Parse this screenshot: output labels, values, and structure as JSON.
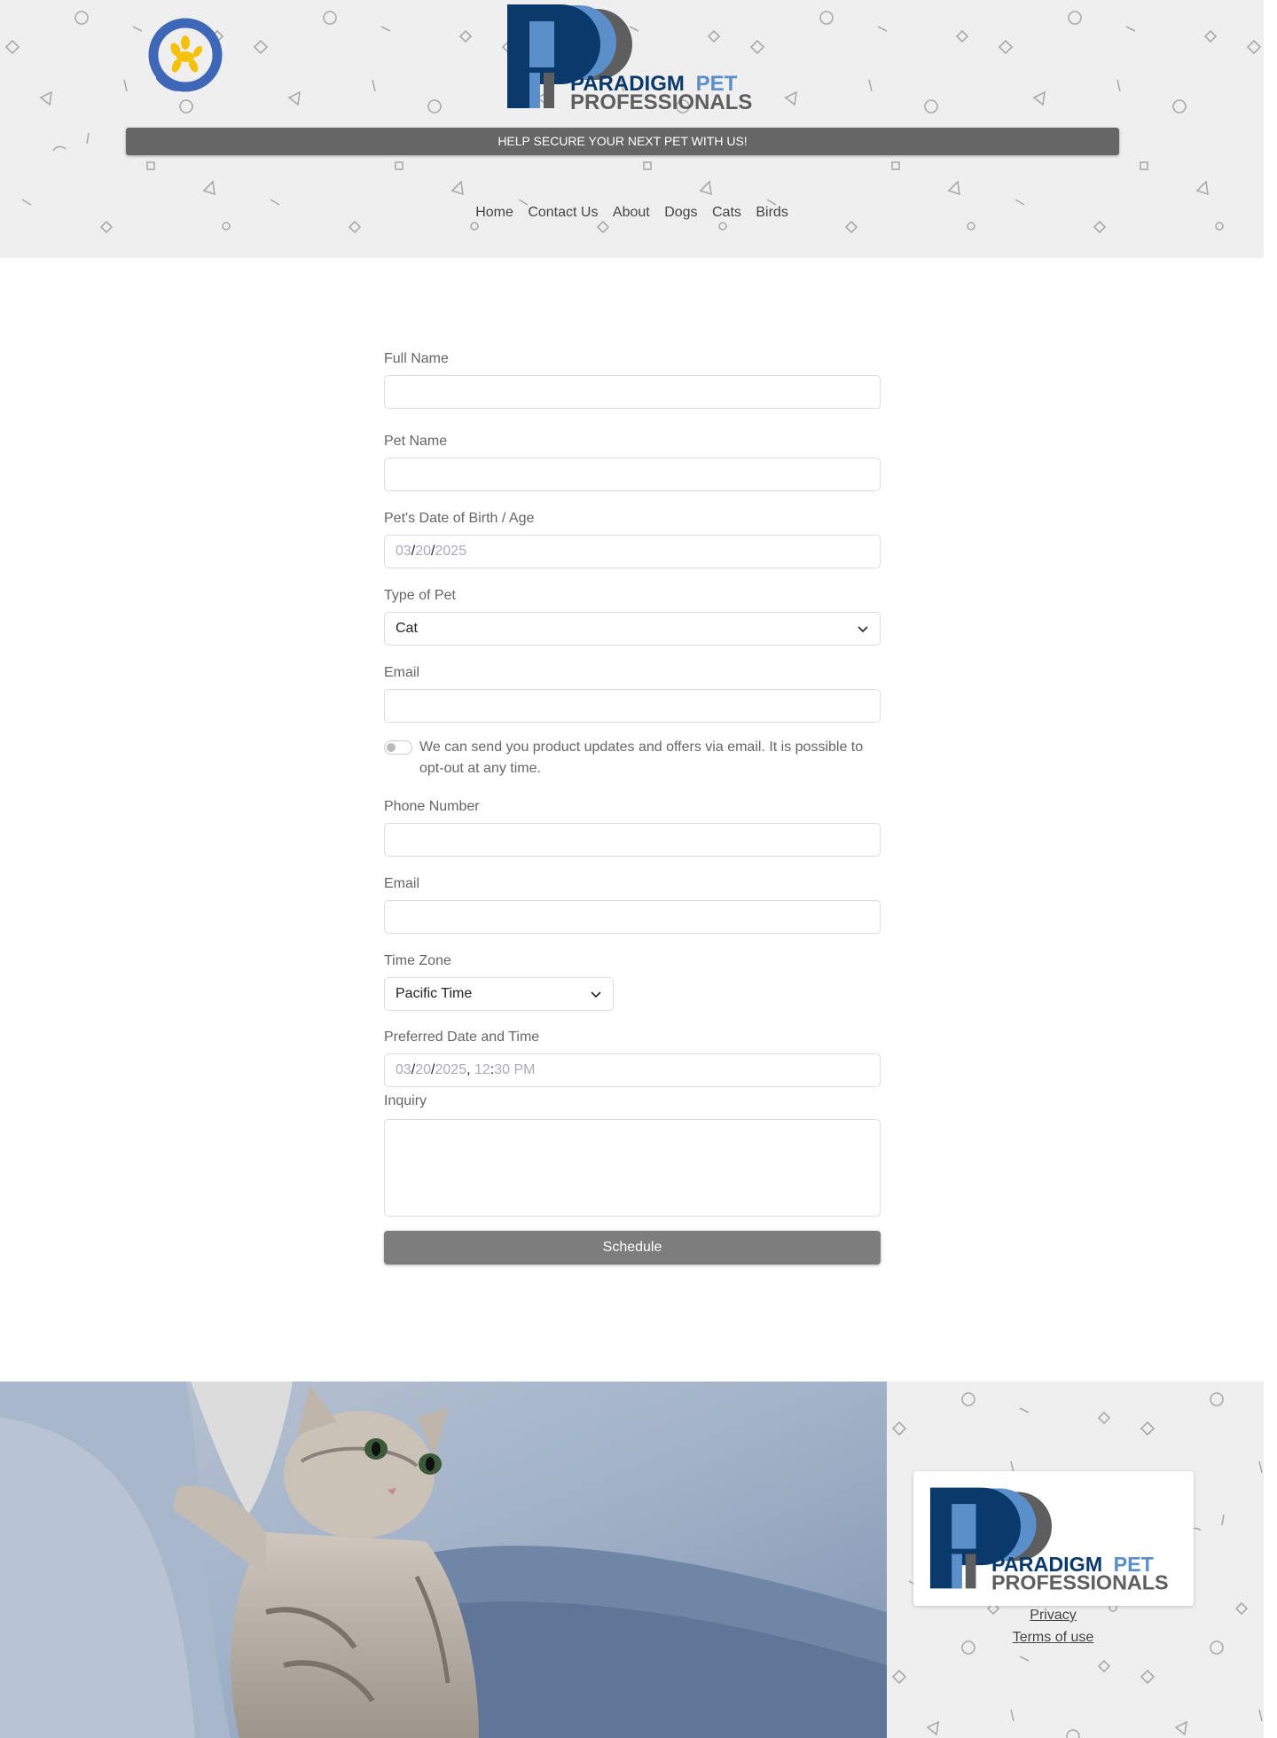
{
  "header": {
    "brand_line1_a": "PARADIGM",
    "brand_line1_b": "PET",
    "brand_line2": "PROFESSIONALS",
    "banner": "HELP SECURE YOUR NEXT PET WITH US!",
    "nav": [
      "Home",
      "Contact Us",
      "About",
      "Dogs",
      "Cats",
      "Birds"
    ]
  },
  "form": {
    "full_name": {
      "label": "Full Name",
      "value": ""
    },
    "pet_name": {
      "label": "Pet Name",
      "value": ""
    },
    "dob": {
      "label": "Pet's Date of Birth / Age",
      "month": "03",
      "day": "20",
      "year": "2025"
    },
    "pet_type": {
      "label": "Type of Pet",
      "value": "Cat"
    },
    "email": {
      "label": "Email",
      "value": ""
    },
    "optin": {
      "text": "We can send you product updates and offers via email. It is possible to opt-out at any time.",
      "checked": false
    },
    "phone": {
      "label": "Phone Number",
      "value": ""
    },
    "email2": {
      "label": "Email",
      "value": ""
    },
    "timezone": {
      "label": "Time Zone",
      "value": "Pacific Time"
    },
    "preferred": {
      "label": "Preferred Date and Time",
      "month": "03",
      "day": "20",
      "year": "2025",
      "hour": "12",
      "minute": "30",
      "ampm": "PM"
    },
    "inquiry": {
      "label": "Inquiry",
      "value": ""
    },
    "submit_label": "Schedule"
  },
  "footer": {
    "privacy": "Privacy",
    "terms": "Terms of use"
  },
  "colors": {
    "brand_navy": "#0a3a6b",
    "brand_blue": "#5b8fc9",
    "brand_gray": "#5e5e5e",
    "mascot_blue": "#3f67b8",
    "mascot_yellow": "#f4c20d",
    "banner_bg": "#666666",
    "button_bg": "#7d7d7d"
  }
}
